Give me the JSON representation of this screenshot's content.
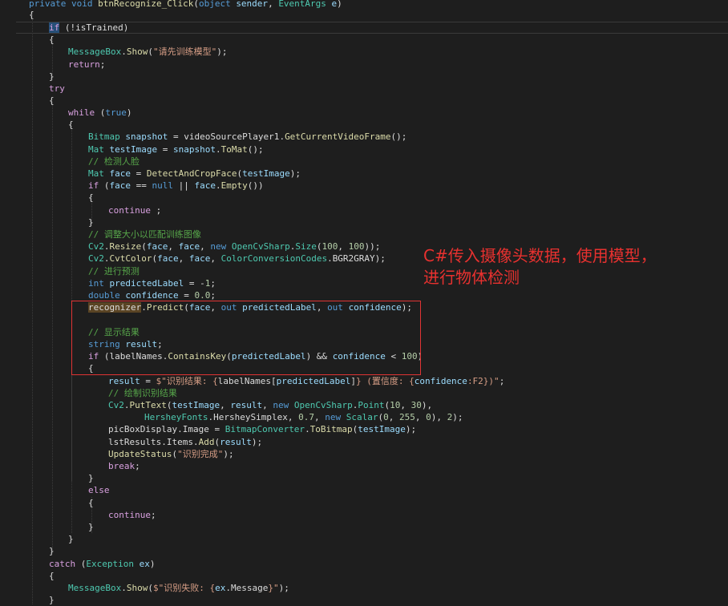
{
  "lines": [
    [
      [
        "kw",
        "private "
      ],
      [
        "kw",
        "void "
      ],
      [
        "fn",
        "btnRecognize_Click"
      ],
      [
        "",
        "("
      ],
      [
        "kw",
        "object "
      ],
      [
        "ptr",
        "sender"
      ],
      [
        "",
        ", "
      ],
      [
        "typ",
        "EventArgs "
      ],
      [
        "ptr",
        "e"
      ],
      [
        "",
        ")"
      ]
    ],
    [
      [
        "",
        "{"
      ]
    ],
    [
      [
        "ctl hl",
        "if"
      ],
      [
        "",
        " (!"
      ],
      [
        "fld",
        "isTrained"
      ],
      [
        "",
        ")"
      ]
    ],
    [
      [
        "",
        "{"
      ]
    ],
    [
      [
        "typ",
        "MessageBox"
      ],
      [
        "",
        "."
      ],
      [
        "fn",
        "Show"
      ],
      [
        "",
        "("
      ],
      [
        "str",
        "\"请先训练模型\""
      ],
      [
        "",
        ");"
      ]
    ],
    [
      [
        "ctl",
        "return"
      ],
      [
        "",
        ";"
      ]
    ],
    [
      [
        "",
        "}"
      ]
    ],
    [
      [
        "ctl",
        "try"
      ]
    ],
    [
      [
        "",
        "{"
      ]
    ],
    [
      [
        "ctl",
        "while "
      ],
      [
        "",
        "("
      ],
      [
        "kw",
        "true"
      ],
      [
        "",
        ")"
      ]
    ],
    [
      [
        "",
        "{"
      ]
    ],
    [
      [
        "typ",
        "Bitmap "
      ],
      [
        "ptr",
        "snapshot"
      ],
      [
        "",
        " = "
      ],
      [
        "fld",
        "videoSourcePlayer1"
      ],
      [
        "",
        "."
      ],
      [
        "fn",
        "GetCurrentVideoFrame"
      ],
      [
        "",
        "();"
      ]
    ],
    [
      [
        "typ",
        "Mat "
      ],
      [
        "ptr",
        "testImage"
      ],
      [
        "",
        " = "
      ],
      [
        "ptr",
        "snapshot"
      ],
      [
        "",
        "."
      ],
      [
        "fn",
        "ToMat"
      ],
      [
        "",
        "();"
      ]
    ],
    [
      [
        "cmt",
        "// 检测人脸"
      ]
    ],
    [
      [
        "typ",
        "Mat "
      ],
      [
        "ptr",
        "face"
      ],
      [
        "",
        " = "
      ],
      [
        "fn",
        "DetectAndCropFace"
      ],
      [
        "",
        "("
      ],
      [
        "ptr",
        "testImage"
      ],
      [
        "",
        ");"
      ]
    ],
    [
      [
        "ctl",
        "if "
      ],
      [
        "",
        "("
      ],
      [
        "ptr",
        "face"
      ],
      [
        "",
        " == "
      ],
      [
        "kw",
        "null"
      ],
      [
        "",
        " || "
      ],
      [
        "ptr",
        "face"
      ],
      [
        "",
        "."
      ],
      [
        "fn",
        "Empty"
      ],
      [
        "",
        "())"
      ]
    ],
    [
      [
        "",
        "{"
      ]
    ],
    [
      [
        "ctl",
        "continue"
      ],
      [
        "",
        " ;"
      ]
    ],
    [
      [
        "",
        "}"
      ]
    ],
    [
      [
        "cmt",
        "// 调整大小以匹配训练图像"
      ]
    ],
    [
      [
        "typ",
        "Cv2"
      ],
      [
        "",
        "."
      ],
      [
        "fn",
        "Resize"
      ],
      [
        "",
        "("
      ],
      [
        "ptr",
        "face"
      ],
      [
        "",
        ", "
      ],
      [
        "ptr",
        "face"
      ],
      [
        "",
        ", "
      ],
      [
        "kw",
        "new "
      ],
      [
        "typ",
        "OpenCvSharp"
      ],
      [
        "",
        "."
      ],
      [
        "typ",
        "Size"
      ],
      [
        "",
        "("
      ],
      [
        "num",
        "100"
      ],
      [
        "",
        ", "
      ],
      [
        "num",
        "100"
      ],
      [
        "",
        "));"
      ]
    ],
    [
      [
        "typ",
        "Cv2"
      ],
      [
        "",
        "."
      ],
      [
        "fn",
        "CvtColor"
      ],
      [
        "",
        "("
      ],
      [
        "ptr",
        "face"
      ],
      [
        "",
        ", "
      ],
      [
        "ptr",
        "face"
      ],
      [
        "",
        ", "
      ],
      [
        "typ",
        "ColorConversionCodes"
      ],
      [
        "",
        "."
      ],
      [
        "fld",
        "BGR2GRAY"
      ],
      [
        "",
        ");"
      ]
    ],
    [
      [
        "cmt",
        "// 进行预测"
      ]
    ],
    [
      [
        "kw",
        "int "
      ],
      [
        "ptr",
        "predictedLabel"
      ],
      [
        "",
        " = -"
      ],
      [
        "num",
        "1"
      ],
      [
        "",
        ";"
      ]
    ],
    [
      [
        "kw",
        "double "
      ],
      [
        "ptr",
        "confidence"
      ],
      [
        "",
        " = "
      ],
      [
        "num",
        "0.0"
      ],
      [
        "",
        ";"
      ]
    ],
    [
      [
        "fld hl2",
        "recognizer"
      ],
      [
        "",
        "."
      ],
      [
        "fn",
        "Predict"
      ],
      [
        "",
        "("
      ],
      [
        "ptr",
        "face"
      ],
      [
        "",
        ", "
      ],
      [
        "kw",
        "out "
      ],
      [
        "ptr",
        "predictedLabel"
      ],
      [
        "",
        ", "
      ],
      [
        "kw",
        "out "
      ],
      [
        "ptr",
        "confidence"
      ],
      [
        "",
        ");"
      ]
    ],
    [
      [
        "",
        ""
      ]
    ],
    [
      [
        "cmt",
        "// 显示结果"
      ]
    ],
    [
      [
        "kw",
        "string "
      ],
      [
        "ptr",
        "result"
      ],
      [
        "",
        ";"
      ]
    ],
    [
      [
        "ctl",
        "if "
      ],
      [
        "",
        "("
      ],
      [
        "fld",
        "labelNames"
      ],
      [
        "",
        "."
      ],
      [
        "fn",
        "ContainsKey"
      ],
      [
        "",
        "("
      ],
      [
        "ptr",
        "predictedLabel"
      ],
      [
        "",
        ") && "
      ],
      [
        "ptr",
        "confidence"
      ],
      [
        "",
        " < "
      ],
      [
        "num",
        "100"
      ],
      [
        "",
        ")"
      ]
    ],
    [
      [
        "",
        "{"
      ]
    ],
    [
      [
        "ptr",
        "result"
      ],
      [
        "",
        " = "
      ],
      [
        "str",
        "$\"识别结果: {"
      ],
      [
        "fld",
        "labelNames"
      ],
      [
        "",
        "["
      ],
      [
        "ptr",
        "predictedLabel"
      ],
      [
        "",
        "]"
      ],
      [
        "str",
        "} (置信度: {"
      ],
      [
        "ptr",
        "confidence"
      ],
      [
        "str",
        ":F2})\""
      ],
      [
        "",
        ";"
      ]
    ],
    [
      [
        "cmt",
        "// 绘制识别结果"
      ]
    ],
    [
      [
        "typ",
        "Cv2"
      ],
      [
        "",
        "."
      ],
      [
        "fn",
        "PutText"
      ],
      [
        "",
        "("
      ],
      [
        "ptr",
        "testImage"
      ],
      [
        "",
        ", "
      ],
      [
        "ptr",
        "result"
      ],
      [
        "",
        ", "
      ],
      [
        "kw",
        "new "
      ],
      [
        "typ",
        "OpenCvSharp"
      ],
      [
        "",
        "."
      ],
      [
        "typ",
        "Point"
      ],
      [
        "",
        "("
      ],
      [
        "num",
        "10"
      ],
      [
        "",
        ", "
      ],
      [
        "num",
        "30"
      ],
      [
        "",
        "),"
      ]
    ],
    [
      [
        "typ",
        "HersheyFonts"
      ],
      [
        "",
        "."
      ],
      [
        "fld",
        "HersheySimplex"
      ],
      [
        "",
        ", "
      ],
      [
        "num",
        "0.7"
      ],
      [
        "",
        ", "
      ],
      [
        "kw",
        "new "
      ],
      [
        "typ",
        "Scalar"
      ],
      [
        "",
        "("
      ],
      [
        "num",
        "0"
      ],
      [
        "",
        ", "
      ],
      [
        "num",
        "255"
      ],
      [
        "",
        ", "
      ],
      [
        "num",
        "0"
      ],
      [
        "",
        "), "
      ],
      [
        "num",
        "2"
      ],
      [
        "",
        ");"
      ]
    ],
    [
      [
        "fld",
        "picBoxDisplay"
      ],
      [
        "",
        "."
      ],
      [
        "fld",
        "Image"
      ],
      [
        "",
        " = "
      ],
      [
        "typ",
        "BitmapConverter"
      ],
      [
        "",
        "."
      ],
      [
        "fn",
        "ToBitmap"
      ],
      [
        "",
        "("
      ],
      [
        "ptr",
        "testImage"
      ],
      [
        "",
        ");"
      ]
    ],
    [
      [
        "fld",
        "lstResults"
      ],
      [
        "",
        "."
      ],
      [
        "fld",
        "Items"
      ],
      [
        "",
        "."
      ],
      [
        "fn",
        "Add"
      ],
      [
        "",
        "("
      ],
      [
        "ptr",
        "result"
      ],
      [
        "",
        ");"
      ]
    ],
    [
      [
        "fn",
        "UpdateStatus"
      ],
      [
        "",
        "("
      ],
      [
        "str",
        "\"识别完成\""
      ],
      [
        "",
        ");"
      ]
    ],
    [
      [
        "ctl",
        "break"
      ],
      [
        "",
        ";"
      ]
    ],
    [
      [
        "",
        "}"
      ]
    ],
    [
      [
        "ctl",
        "else"
      ]
    ],
    [
      [
        "",
        "{"
      ]
    ],
    [
      [
        "ctl",
        "continue"
      ],
      [
        "",
        ";"
      ]
    ],
    [
      [
        "",
        "}"
      ]
    ],
    [
      [
        "",
        "}"
      ]
    ],
    [
      [
        "",
        "}"
      ]
    ],
    [
      [
        "ctl",
        "catch "
      ],
      [
        "",
        "("
      ],
      [
        "typ",
        "Exception "
      ],
      [
        "ptr",
        "ex"
      ],
      [
        "",
        ")"
      ]
    ],
    [
      [
        "",
        "{"
      ]
    ],
    [
      [
        "typ",
        "MessageBox"
      ],
      [
        "",
        "."
      ],
      [
        "fn",
        "Show"
      ],
      [
        "",
        "("
      ],
      [
        "str",
        "$\"识别失败: {"
      ],
      [
        "ptr",
        "ex"
      ],
      [
        "",
        "."
      ],
      [
        "fld",
        "Message"
      ],
      [
        "str",
        "}\""
      ],
      [
        "",
        ");"
      ]
    ],
    [
      [
        "",
        "}"
      ]
    ]
  ],
  "annotation": {
    "line1": "C#传入摄像头数据，使用模型，",
    "line2": "进行物体检测"
  }
}
